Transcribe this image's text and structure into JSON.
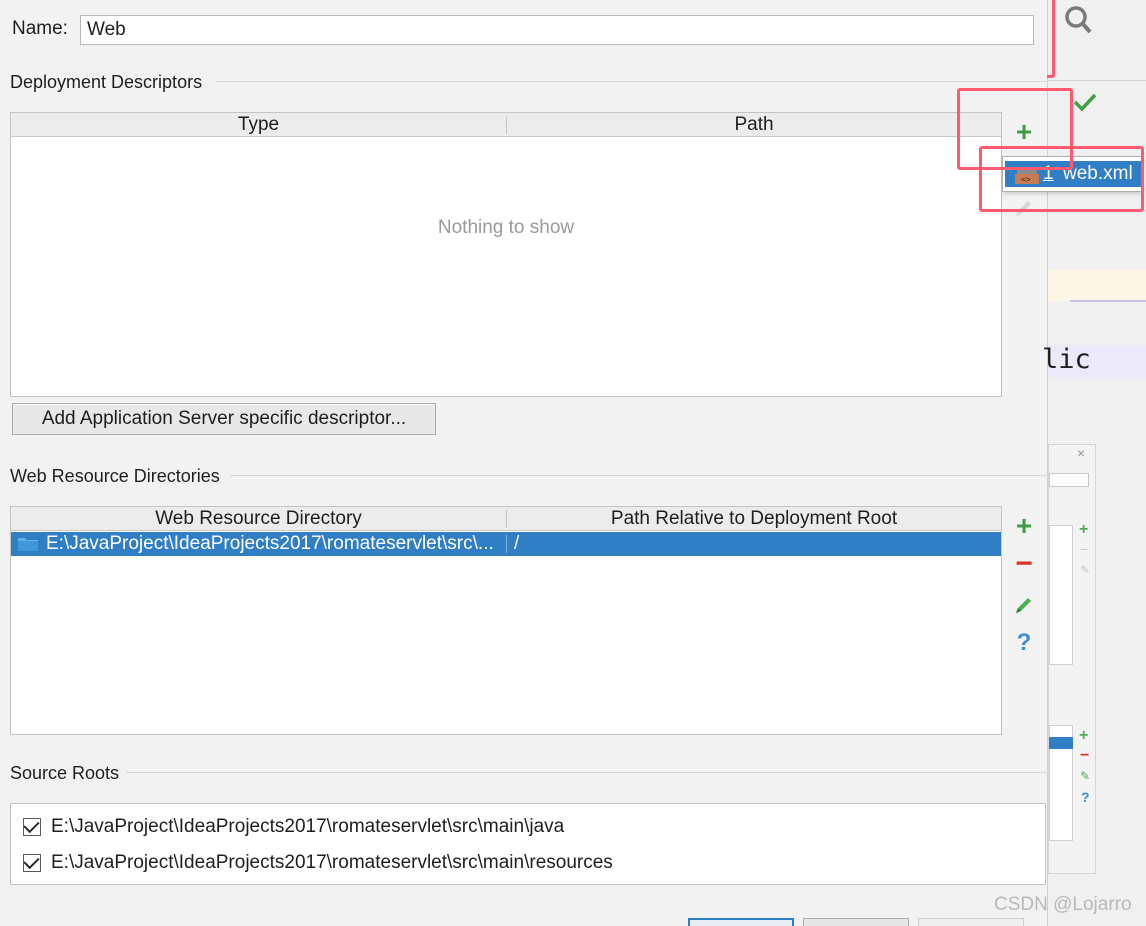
{
  "name_field": {
    "label": "Name:",
    "value": "Web"
  },
  "deployment": {
    "section_title": "Deployment Descriptors",
    "columns": [
      "Type",
      "Path"
    ],
    "empty_text": "Nothing to show",
    "add_server_button": "Add Application Server specific descriptor...",
    "popup_item_number": "1",
    "popup_item_label": "web.xml"
  },
  "web_resources": {
    "section_title": "Web Resource Directories",
    "columns": [
      "Web Resource Directory",
      "Path Relative to Deployment Root"
    ],
    "rows": [
      {
        "directory": "E:\\JavaProject\\IdeaProjects2017\\romateservlet\\src\\...",
        "path": "/"
      }
    ]
  },
  "source_roots": {
    "section_title": "Source Roots",
    "items": [
      {
        "checked": true,
        "path": "E:\\JavaProject\\IdeaProjects2017\\romateservlet\\src\\main\\java"
      },
      {
        "checked": true,
        "path": "E:\\JavaProject\\IdeaProjects2017\\romateservlet\\src\\main\\resources"
      }
    ]
  },
  "background": {
    "code_fragment": "lic"
  },
  "watermark": "CSDN @Lojarro",
  "colors": {
    "selection": "#2f7ec6",
    "highlight": "#ff5a6e",
    "add": "#3e9c46",
    "remove": "#d6372c",
    "help": "#3c8fd4"
  }
}
